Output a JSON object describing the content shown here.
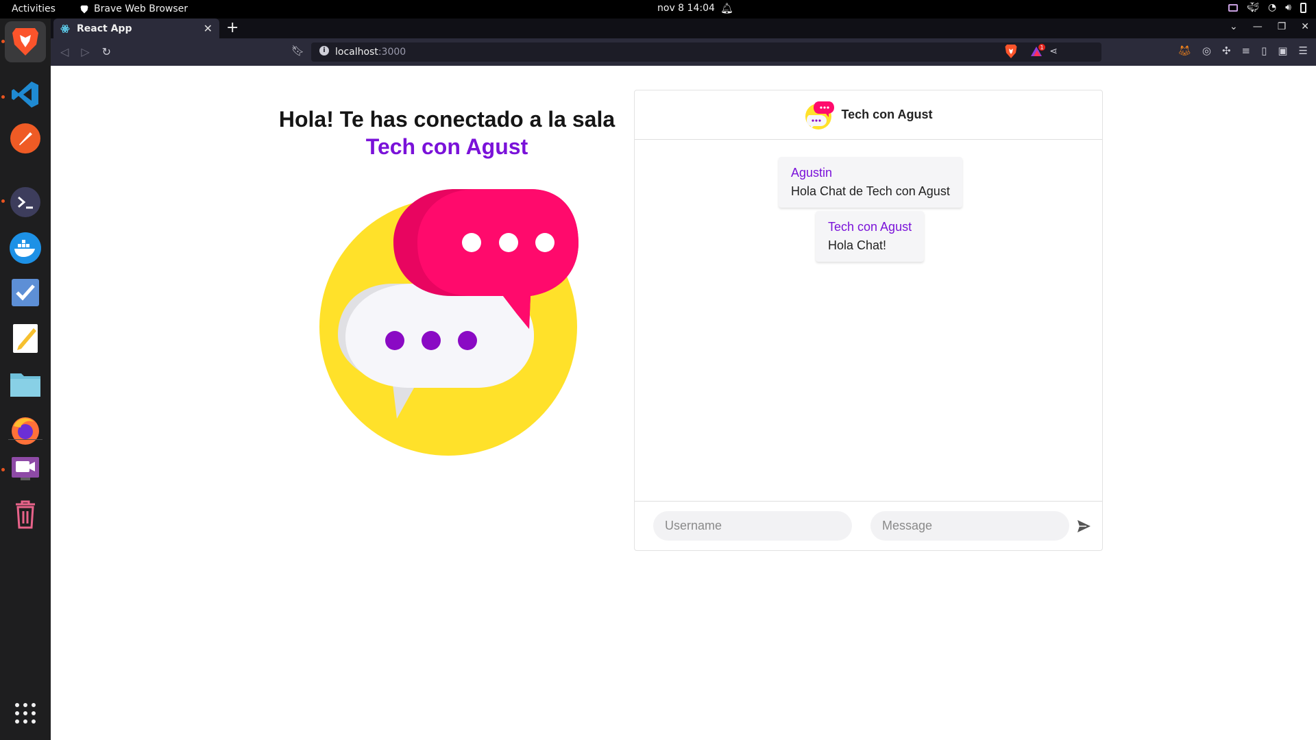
{
  "topbar": {
    "activities": "Activities",
    "app_name": "Brave Web Browser",
    "datetime": "nov 8  14:04"
  },
  "dock": {
    "items": [
      "brave-browser",
      "vscode",
      "postman",
      "terminal",
      "docker",
      "tasks",
      "text-editor",
      "files",
      "firefox",
      "screen-recorder",
      "trash",
      "show-apps"
    ]
  },
  "browser": {
    "tab_title": "React App",
    "url_host": "localhost",
    "url_port": ":3000",
    "rewards_badge": "1"
  },
  "page": {
    "heading_line1": "Hola! Te has conectado a la sala",
    "heading_room": "Tech con Agust",
    "accent_color": "#7a12d9"
  },
  "chat": {
    "header_title": "Tech con Agust",
    "messages": [
      {
        "user": "Agustin",
        "text": "Hola Chat de Tech con Agust"
      },
      {
        "user": "Tech con Agust",
        "text": "Hola Chat!"
      }
    ],
    "username_placeholder": "Username",
    "message_placeholder": "Message"
  },
  "colors": {
    "yellow": "#ffe12a",
    "pink": "#ff0a6c",
    "purple_dots": "#8a0ac4",
    "bubble_white": "#f6f6fa"
  }
}
